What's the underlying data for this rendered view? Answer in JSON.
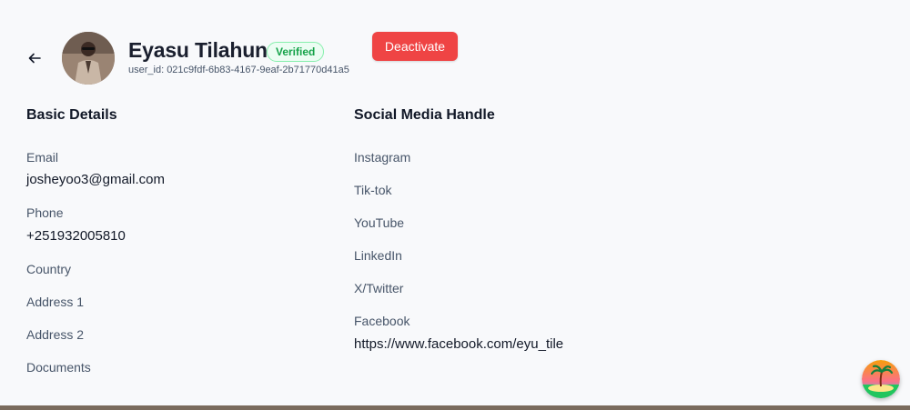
{
  "header": {
    "name": "Eyasu Tilahun",
    "status_badge": "Verified",
    "user_id": "user_id: 021c9fdf-6b83-4167-9eaf-2b71770d41a5",
    "deactivate_label": "Deactivate"
  },
  "basic": {
    "title": "Basic Details",
    "email_label": "Email",
    "email_value": "josheyoo3@gmail.com",
    "phone_label": "Phone",
    "phone_value": "+251932005810",
    "country_label": "Country",
    "address1_label": "Address 1",
    "address2_label": "Address 2",
    "documents_label": "Documents"
  },
  "social": {
    "title": "Social Media Handle",
    "instagram_label": "Instagram",
    "tiktok_label": "Tik-tok",
    "youtube_label": "YouTube",
    "linkedin_label": "LinkedIn",
    "twitter_label": "X/Twitter",
    "facebook_label": "Facebook",
    "facebook_value": "https://www.facebook.com/eyu_tile"
  },
  "colors": {
    "accent_danger": "#ef4444",
    "verified_green": "#16a34a"
  }
}
